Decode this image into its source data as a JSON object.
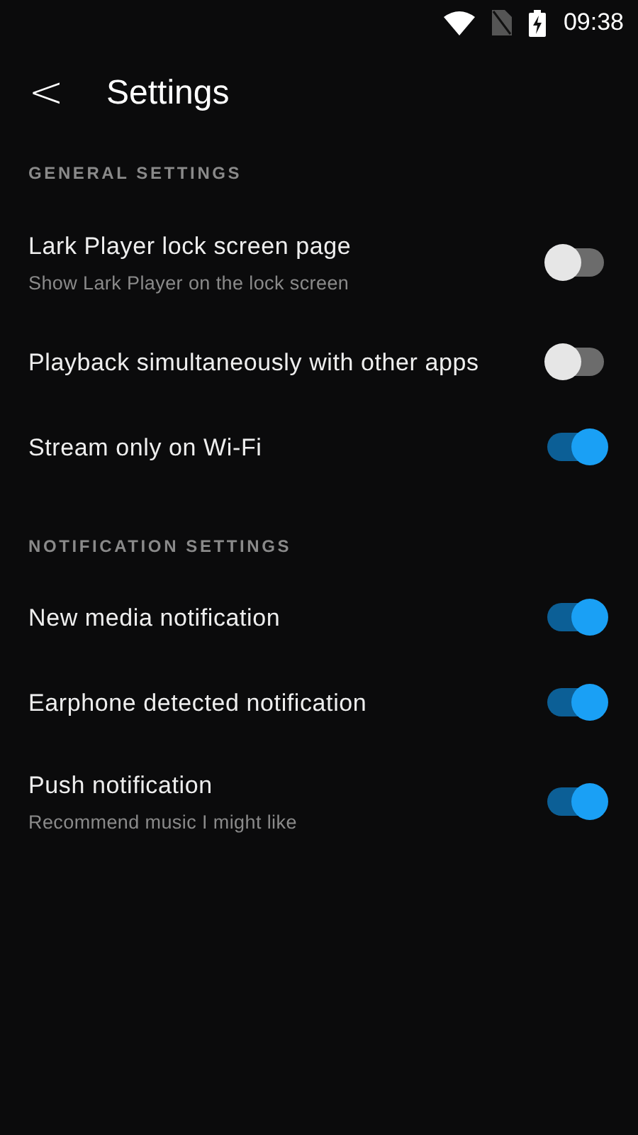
{
  "status_bar": {
    "time": "09:38"
  },
  "header": {
    "back": "<",
    "title": "Settings"
  },
  "sections": [
    {
      "title": "GENERAL SETTINGS",
      "items": [
        {
          "label": "Lark Player lock screen page",
          "subtitle": "Show Lark Player on the lock screen",
          "on": false
        },
        {
          "label": "Playback simultaneously with other apps",
          "on": false
        },
        {
          "label": "Stream only on Wi-Fi",
          "on": true
        }
      ]
    },
    {
      "title": "NOTIFICATION SETTINGS",
      "items": [
        {
          "label": "New media notification",
          "on": true
        },
        {
          "label": "Earphone detected notification",
          "on": true
        },
        {
          "label": "Push notification",
          "subtitle": "Recommend music I might like",
          "on": true
        }
      ]
    }
  ]
}
